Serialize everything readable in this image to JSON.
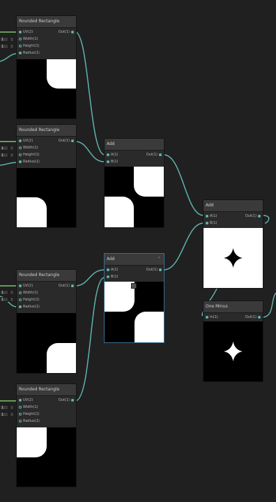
{
  "graph": {
    "nodes": {
      "rounded_rect_1": {
        "title": "Rounded Rectangle",
        "inputs": [
          "UV(2)",
          "Width(1)",
          "Height(1)",
          "Radius(1)"
        ],
        "output": "Out(1)",
        "width_value": "1",
        "height_value": "1"
      },
      "rounded_rect_2": {
        "title": "Rounded Rectangle",
        "inputs": [
          "UV(2)",
          "Width(1)",
          "Height(1)",
          "Radius(1)"
        ],
        "output": "Out(1)",
        "width_value": "1",
        "height_value": "1"
      },
      "rounded_rect_3": {
        "title": "Rounded Rectangle",
        "inputs": [
          "UV(2)",
          "Width(1)",
          "Height(1)",
          "Radius(1)"
        ],
        "output": "Out(1)",
        "width_value": "1",
        "height_value": "1"
      },
      "rounded_rect_4": {
        "title": "Rounded Rectangle",
        "inputs": [
          "UV(2)",
          "Width(1)",
          "Height(1)",
          "Radius(1)"
        ],
        "output": "Out(1)",
        "width_value": "1",
        "height_value": "1"
      },
      "add_1": {
        "title": "Add",
        "inputs": [
          "A(1)",
          "B(1)"
        ],
        "output": "Out(1)"
      },
      "add_2": {
        "title": "Add",
        "inputs": [
          "A(1)",
          "B(1)"
        ],
        "output": "Out(1)"
      },
      "add_3": {
        "title": "Add",
        "inputs": [
          "A(1)",
          "B(1)"
        ],
        "output": "Out(1)"
      },
      "one_minus": {
        "title": "One Minus",
        "inputs": [
          "In(1)"
        ],
        "output": "Out(1)"
      }
    }
  },
  "colors": {
    "background": "#202020",
    "wire": "#5fb3ad",
    "uv_wire": "#7bc66a",
    "node_body": "#2a2a2a",
    "node_header": "#3a3a3a"
  },
  "icons": {
    "collapse": "chevron-up-icon",
    "preview_toggle": "preview-toggle-icon"
  }
}
